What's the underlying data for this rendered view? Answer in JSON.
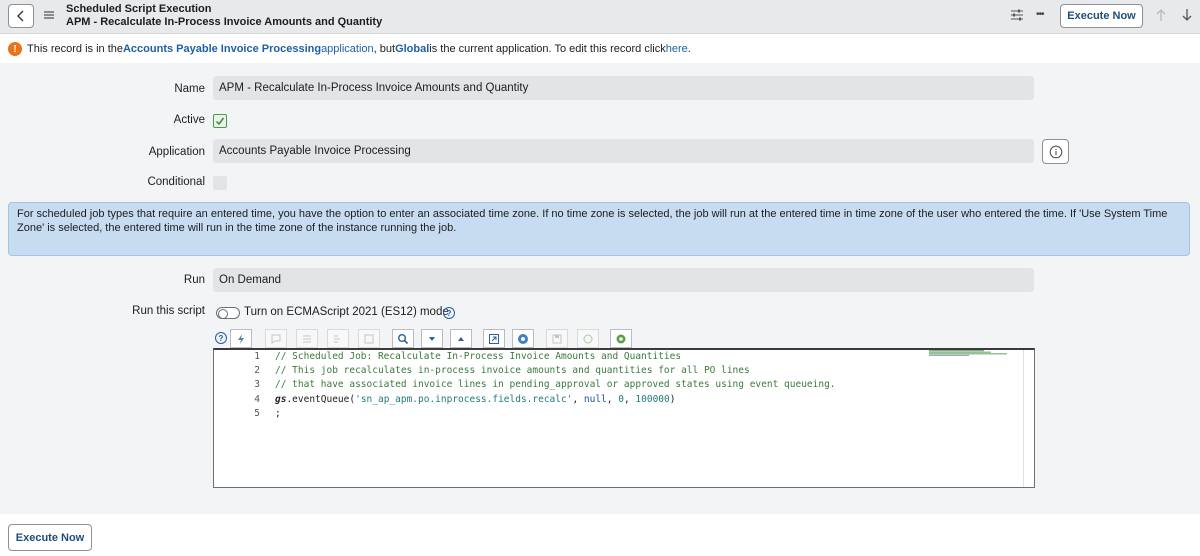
{
  "header": {
    "record_type": "Scheduled Script Execution",
    "record_name": "APM - Recalculate In-Process Invoice Amounts and Quantity",
    "execute_now_label": "Execute Now",
    "more_label": "•••"
  },
  "notice": {
    "part1": "This record is in the ",
    "app_link": "Accounts Payable Invoice Processing",
    "app_word": " application",
    "part2": ", but ",
    "scope_link": "Global",
    "part3": " is the current application. To edit this record click ",
    "here_link": "here",
    "part4": "."
  },
  "form": {
    "name_label": "Name",
    "name_value": "APM - Recalculate In-Process Invoice Amounts and Quantity",
    "active_label": "Active",
    "active_checked": true,
    "application_label": "Application",
    "application_value": "Accounts Payable Invoice Processing",
    "conditional_label": "Conditional",
    "conditional_checked": false,
    "timezone_info": "For scheduled job types that require an entered time, you have the option to enter an associated time zone. If no time zone is selected, the job will run at the entered time in time zone of the user who entered the time. If 'Use System Time Zone' is selected, the entered time will run in the time zone of the instance running the job.",
    "run_label": "Run",
    "run_value": "On Demand",
    "run_script_label": "Run this script",
    "es_mode_label": "Turn on ECMAScript 2021 (ES12) mode",
    "es_mode_on": false
  },
  "editor": {
    "line_numbers": [
      "1",
      "2",
      "3",
      "4",
      "5"
    ],
    "line1": "// Scheduled Job: Recalculate In-Process Invoice Amounts and Quantities",
    "line2": "// This job recalculates in-process invoice amounts and quantities for all PO lines",
    "line3": "// that have associated invoice lines in pending_approval or approved states using event queueing.",
    "line4_obj": "gs",
    "line4_method": ".eventQueue(",
    "line4_str": "'sn_ap_apm.po.inprocess.fields.recalc'",
    "line4_sep1": ", ",
    "line4_null": "null",
    "line4_sep2": ", ",
    "line4_num1": "0",
    "line4_sep3": ", ",
    "line4_num2": "100000",
    "line4_end": ")",
    "line5": ";"
  },
  "footer": {
    "execute_now_label": "Execute Now"
  },
  "colors": {
    "accent": "#1f4e79",
    "link": "#1f5fa8",
    "warning": "#e8731a",
    "info_box": "#c7dcf1",
    "comment": "#3a7a3a"
  }
}
